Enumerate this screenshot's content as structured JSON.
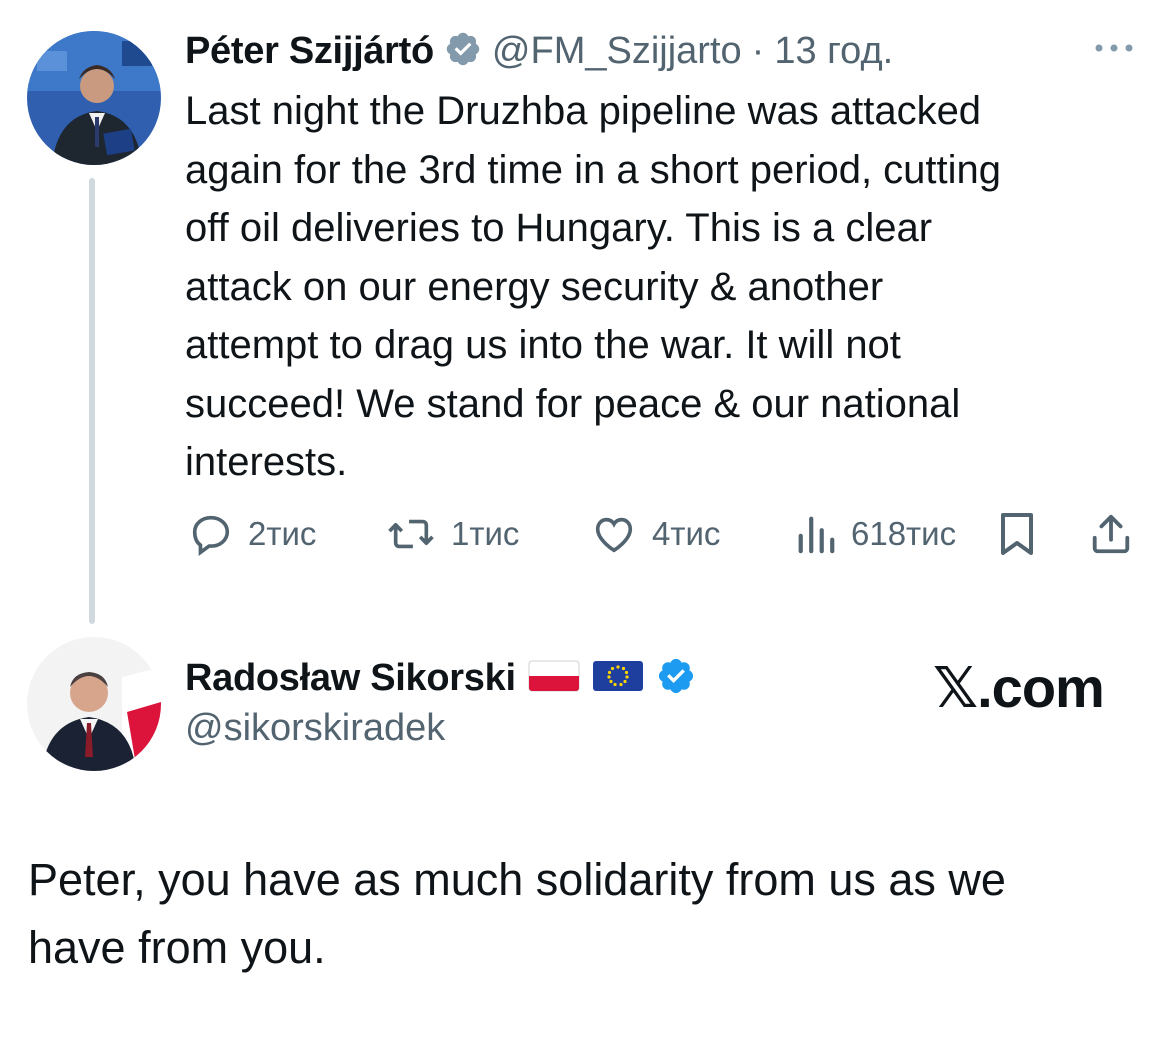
{
  "tweet": {
    "author_name": "Péter Szijjártó",
    "handle": "@FM_Szijjarto",
    "separator": "·",
    "time": "13 год.",
    "text": "Last night the Druzhba pipeline was attacked\nagain for the 3rd time in a short period, cutting\noff oil deliveries to Hungary. This is a clear\nattack on our energy security & another\nattempt to drag us into the war. It will not\nsucceed! We stand for peace & our national\ninterests.",
    "actions": {
      "replies": "2тис",
      "reposts": "1тис",
      "likes": "4тис",
      "views": "618тис"
    },
    "icons": [
      "verified-badge-icon",
      "more-icon",
      "reply-icon",
      "repost-icon",
      "like-icon",
      "views-icon",
      "bookmark-icon",
      "share-icon"
    ]
  },
  "reply": {
    "author_name": "Radosław Sikorski",
    "handle": "@sikorskiradek",
    "flags": [
      "poland-flag-icon",
      "eu-flag-icon"
    ],
    "text": "Peter, you have as much solidarity from us as we\nhave from you."
  },
  "watermark": "𝕏.com",
  "colors": {
    "text": "#0f1419",
    "secondary": "#536471",
    "verified": "#1d9bf0",
    "thread_line": "#cfd9de"
  }
}
